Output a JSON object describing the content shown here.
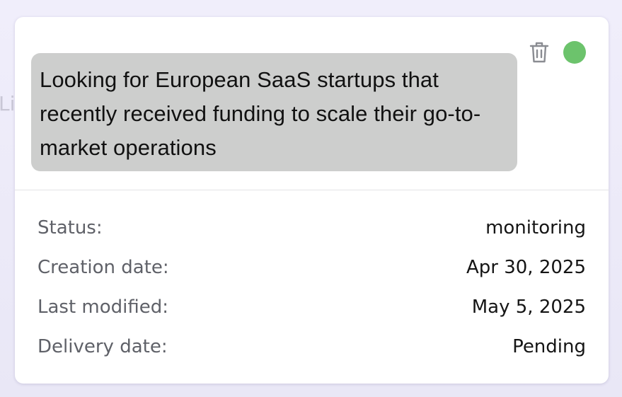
{
  "background": {
    "partial_text": "Li"
  },
  "card": {
    "query": "Looking for European SaaS startups that recently received funding to scale their go-to-market operations",
    "status_indicator_color": "#6cc36c",
    "icons": {
      "delete": "trash-icon"
    },
    "details": [
      {
        "label": "Status:",
        "value": "monitoring"
      },
      {
        "label": "Creation date:",
        "value": "Apr 30, 2025"
      },
      {
        "label": "Last modified:",
        "value": "May 5, 2025"
      },
      {
        "label": "Delivery date:",
        "value": "Pending"
      }
    ]
  }
}
